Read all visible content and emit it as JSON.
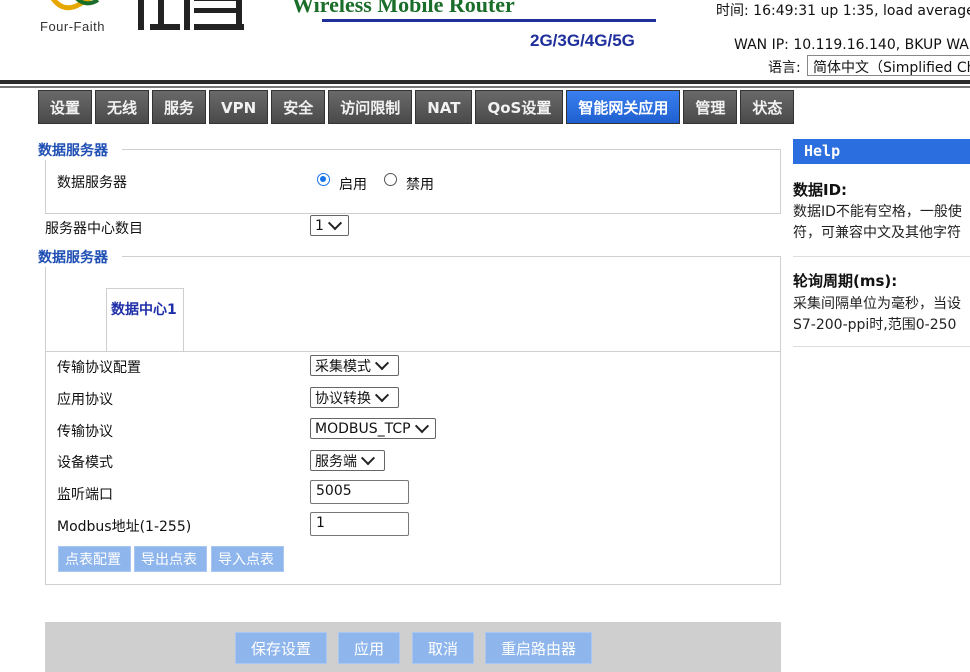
{
  "header": {
    "logo_brand": "Four-Faith",
    "product_title": "Wireless Mobile Router",
    "product_subtitle": "2G/3G/4G/5G",
    "status_time": "时间: 16:49:31 up 1:35, load average:",
    "wan_ip": "WAN IP: 10.119.16.140, BKUP WAN",
    "language_label": "语言:",
    "language_value": "简体中文（Simplified Ch"
  },
  "nav": {
    "tabs": [
      "设置",
      "无线",
      "服务",
      "VPN",
      "安全",
      "访问限制",
      "NAT",
      "QoS设置",
      "智能网关应用",
      "管理",
      "状态"
    ],
    "active_index": 8
  },
  "data_server": {
    "legend": "数据服务器",
    "label": "数据服务器",
    "enable_label": "启用",
    "disable_label": "禁用",
    "selected": "启用"
  },
  "center_count": {
    "label": "服务器中心数目",
    "value": "1"
  },
  "data_server2": {
    "legend": "数据服务器",
    "tab_label": "数据中心1",
    "fields": {
      "transport_config_label": "传输协议配置",
      "transport_config_value": "采集模式",
      "app_protocol_label": "应用协议",
      "app_protocol_value": "协议转换",
      "transport_protocol_label": "传输协议",
      "transport_protocol_value": "MODBUS_TCP",
      "device_mode_label": "设备模式",
      "device_mode_value": "服务端",
      "listen_port_label": "监听端口",
      "listen_port_value": "5005",
      "modbus_addr_label": "Modbus地址(1-255)",
      "modbus_addr_value": "1"
    },
    "buttons": {
      "point_config": "点表配置",
      "export_points": "导出点表",
      "import_points": "导入点表"
    }
  },
  "footer_buttons": {
    "save": "保存设置",
    "apply": "应用",
    "cancel": "取消",
    "reboot": "重启路由器"
  },
  "help": {
    "header": "Help",
    "items": [
      {
        "title": "数据ID:",
        "lines": [
          "数据ID不能有空格，一般使",
          "符，可兼容中文及其他字符"
        ]
      },
      {
        "title": "轮询周期(ms):",
        "lines": [
          "采集间隔单位为毫秒，当设",
          "S7-200-ppi时,范围0-250"
        ]
      }
    ]
  },
  "colors": {
    "accent": "#2b6ee0",
    "legend": "#1f4fb4",
    "button": "#8fb6ec",
    "nav_tab": "#5a5a5a"
  }
}
